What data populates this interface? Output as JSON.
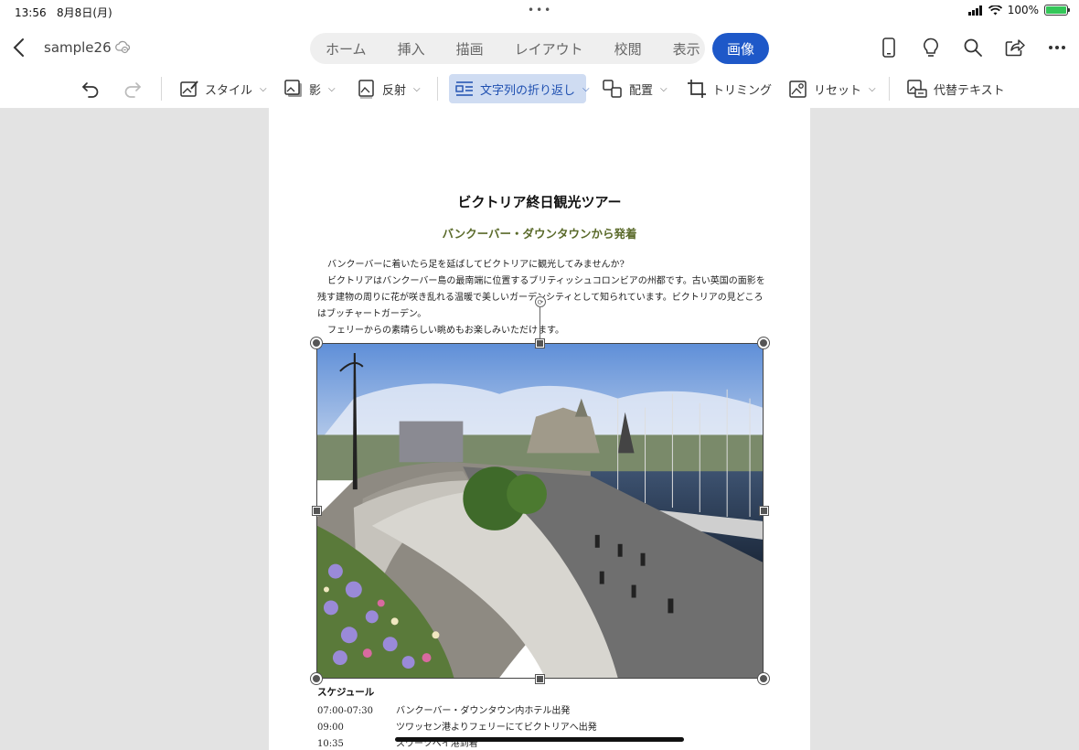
{
  "status": {
    "time": "13:56",
    "date": "8月8日(月)",
    "battery": "100%"
  },
  "app": {
    "doc_title": "sample26"
  },
  "tabs": [
    {
      "label": "ホーム"
    },
    {
      "label": "挿入"
    },
    {
      "label": "描画"
    },
    {
      "label": "レイアウト"
    },
    {
      "label": "校閲"
    },
    {
      "label": "表示"
    }
  ],
  "active_tab": {
    "label": "画像"
  },
  "ribbon": {
    "style": "スタイル",
    "shadow": "影",
    "reflection": "反射",
    "wrap": "文字列の折り返し",
    "position": "配置",
    "crop": "トリミング",
    "reset": "リセット",
    "alt_text": "代替テキスト"
  },
  "document": {
    "title": "ビクトリア終日観光ツアー",
    "subtitle": "バンクーバー・ダウンタウンから発着",
    "paragraphs": [
      "バンクーバーに着いたら足を延ばしてビクトリアに観光してみませんか?",
      "ビクトリアはバンクーバー島の最南端に位置するブリティッシュコロンビアの州都です。古い英国の面影を残す建物の周りに花が咲き乱れる温暖で美しいガーデンシティとして知られています。ビクトリアの見どころはブッチャートガーデン。",
      "フェリーからの素晴らしい眺めもお楽しみいただけます。"
    ],
    "schedule_title": "スケジュール",
    "schedule": [
      {
        "time": "07:00-07:30",
        "desc": "バンクーバー・ダウンタウン内ホテル出発"
      },
      {
        "time": "09:00",
        "desc": "ツワッセン港よりフェリーにてビクトリアへ出発"
      },
      {
        "time": "10:35",
        "desc": "スワーツベイ港到着"
      }
    ]
  },
  "colors": {
    "accent": "#1e58c8",
    "subtitle": "#5a6a2a",
    "wrap_active_bg": "#cfdcf2"
  }
}
